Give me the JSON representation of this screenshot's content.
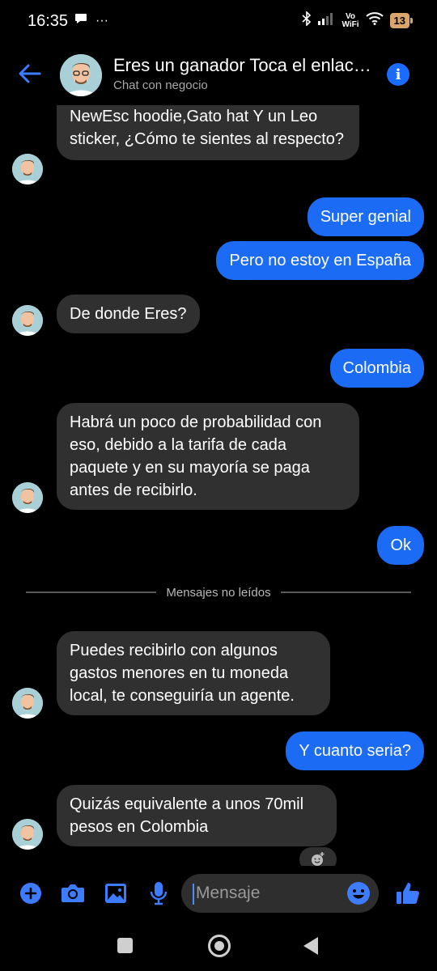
{
  "status_bar": {
    "time": "16:35",
    "more": "···",
    "volte_top": "Vo",
    "volte_bottom": "WiFi",
    "battery": "13"
  },
  "header": {
    "title": "Eres un ganador Toca el enlace para...",
    "subtitle": "Chat con negocio"
  },
  "messages": [
    {
      "from": "business",
      "text": "NewEsc hoodie,Gato hat Y un Leo sticker, ¿Cómo te sientes al respecto?"
    },
    {
      "from": "me",
      "text": "Super genial"
    },
    {
      "from": "me",
      "text": "Pero no estoy en España"
    },
    {
      "from": "business",
      "text": "De donde Eres?"
    },
    {
      "from": "me",
      "text": "Colombia"
    },
    {
      "from": "business",
      "text": "Habrá un poco de probabilidad con eso, debido a la tarifa de cada paquete y en su mayoría se paga antes de recibirlo."
    },
    {
      "from": "me",
      "text": "Ok"
    },
    {
      "from": "business",
      "text": "Puedes recibirlo con algunos gastos menores en tu moneda local, te conseguiría un agente."
    },
    {
      "from": "me",
      "text": "Y cuanto seria?"
    },
    {
      "from": "business",
      "text": "Quizás equivalente a unos 70mil pesos en Colombia"
    }
  ],
  "divider_label": "Mensajes no leídos",
  "composer": {
    "placeholder": "Mensaje"
  },
  "colors": {
    "accent": "#1b6bf5",
    "incoming_bubble": "#303030",
    "background": "#000000",
    "icon_blue": "#3d7bff"
  }
}
